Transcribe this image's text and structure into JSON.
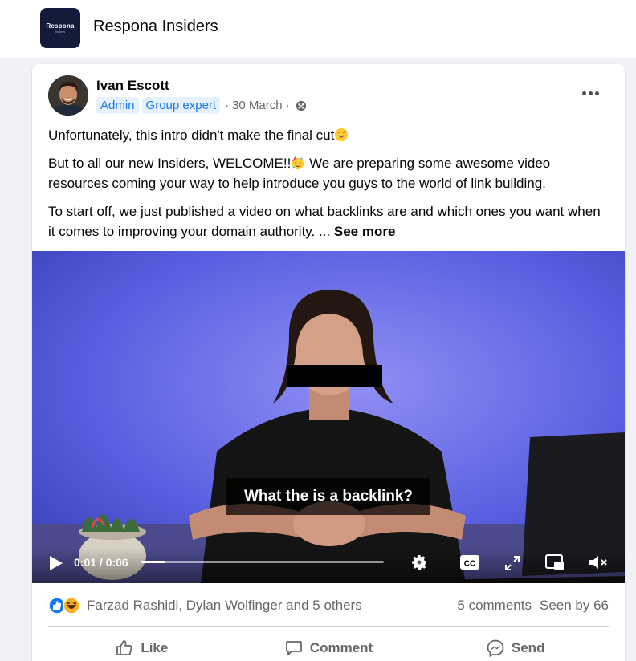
{
  "group": {
    "logo_text": "Respona",
    "logo_subtext": "Insiders",
    "name": "Respona Insiders"
  },
  "post": {
    "author": "Ivan Escott",
    "badges": [
      "Admin",
      "Group expert"
    ],
    "date": "30 March",
    "separator": "·",
    "icons": {
      "privacy": "globe-icon",
      "menu": "more-options-icon"
    },
    "text": {
      "p1": "Unfortunately, this intro didn't make the final cut",
      "p2": "But to all our new Insiders, WELCOME!!",
      "p2b": " We are preparing some awesome video resources coming your way to help introduce you guys to the world of link building.",
      "p3": "To start off, we just published a video on what backlinks are and which ones you want when it comes to improving your domain authority. ... ",
      "see_more": "See more"
    }
  },
  "video": {
    "caption": "What the is a backlink?",
    "time": "0:01 / 0:06",
    "progress": 0.1,
    "icons": [
      "play-icon",
      "settings-icon",
      "captions-icon",
      "fullscreen-icon",
      "pip-icon",
      "mute-icon"
    ],
    "colors": {
      "background": "#5a5fe0"
    }
  },
  "engagement": {
    "reactions": [
      "like-icon",
      "haha-icon"
    ],
    "reactors": "Farzad Rashidi, Dylan Wolfinger and 5 others",
    "comments": "5 comments",
    "seen_by": "Seen by 66"
  },
  "actions": {
    "like": "Like",
    "comment": "Comment",
    "send": "Send"
  },
  "colors": {
    "accent": "#1877f2",
    "badge_bg": "#e7f0fd",
    "secondary_text": "#65676b"
  }
}
